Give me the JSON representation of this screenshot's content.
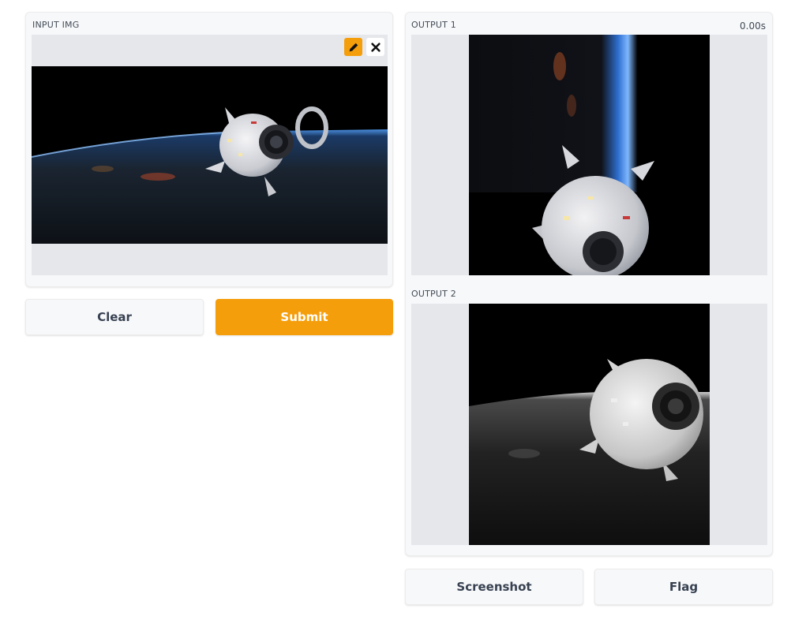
{
  "input_panel": {
    "label": "INPUT IMG",
    "tools": {
      "edit_icon": "pencil-icon",
      "clear_icon": "close-icon"
    }
  },
  "buttons": {
    "clear": "Clear",
    "submit": "Submit",
    "screenshot": "Screenshot",
    "flag": "Flag"
  },
  "output1": {
    "label": "OUTPUT 1",
    "timer": "0.00s"
  },
  "output2": {
    "label": "OUTPUT 2"
  },
  "colors": {
    "accent": "#f59e0b",
    "panel_bg": "#f7f8fa",
    "image_bg": "#e5e7eb"
  }
}
